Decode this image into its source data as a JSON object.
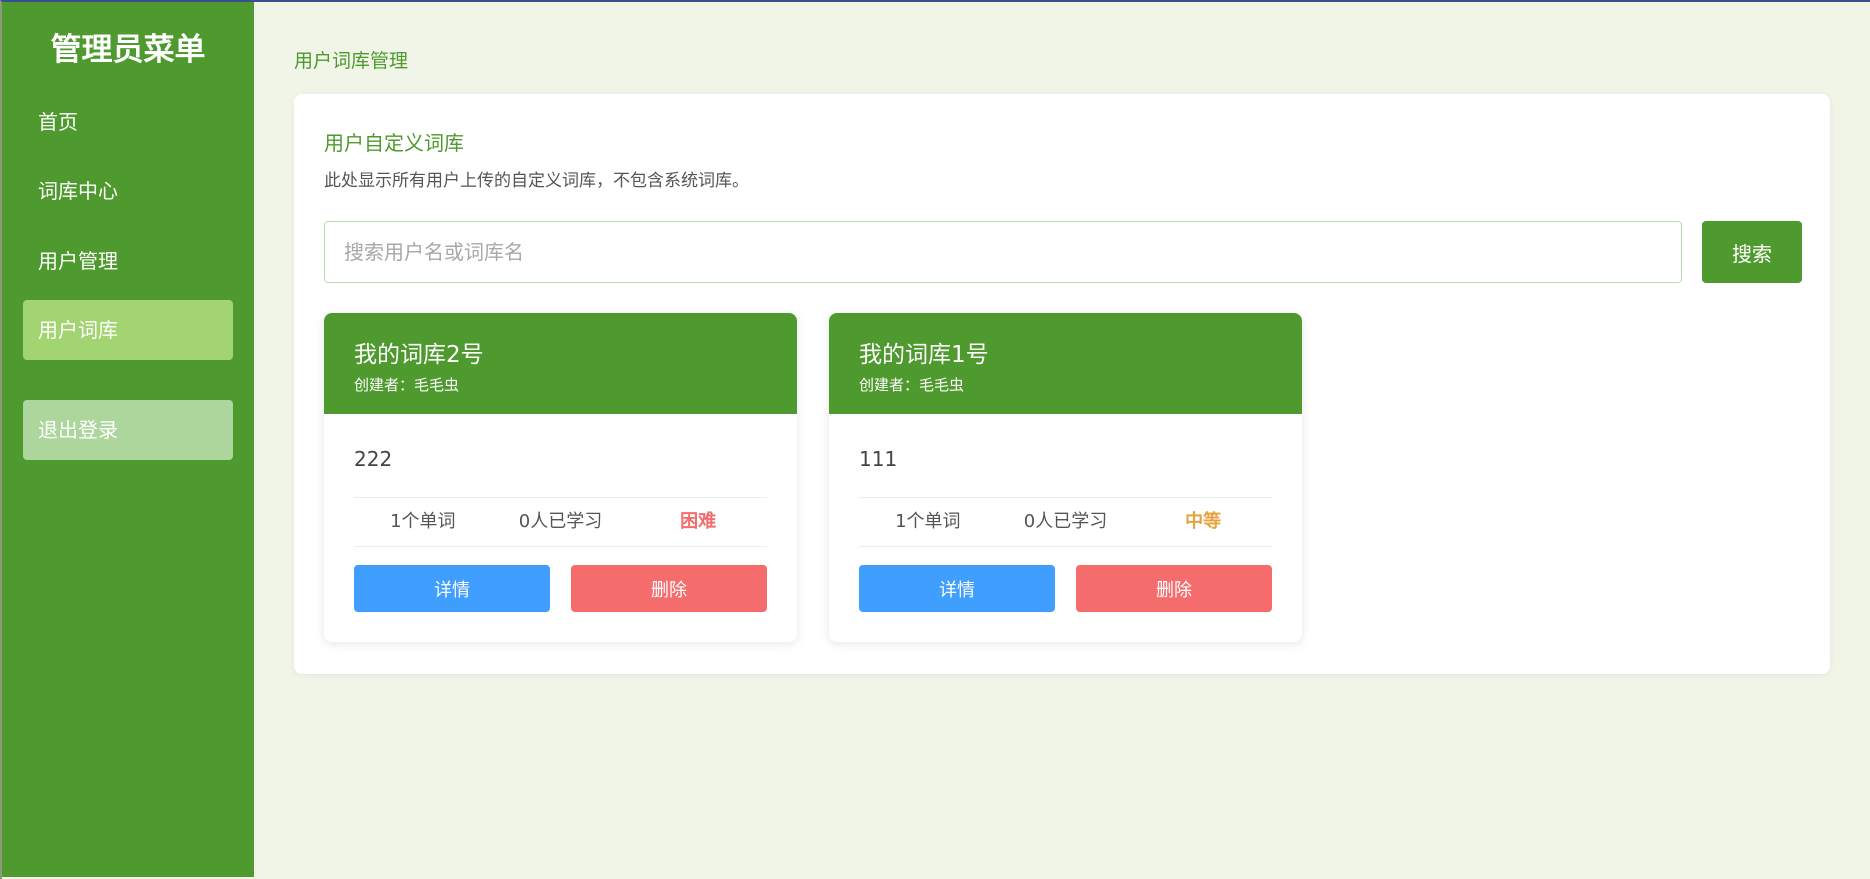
{
  "sidebar": {
    "title": "管理员菜单",
    "items": [
      {
        "label": "首页"
      },
      {
        "label": "词库中心"
      },
      {
        "label": "用户管理"
      },
      {
        "label": "用户词库"
      }
    ],
    "logout_label": "退出登录"
  },
  "main": {
    "breadcrumb": "用户词库管理",
    "section_title": "用户自定义词库",
    "section_desc": "此处显示所有用户上传的自定义词库，不包含系统词库。",
    "search": {
      "placeholder": "搜索用户名或词库名",
      "value": "",
      "button_label": "搜索"
    },
    "cards": [
      {
        "title": "我的词库2号",
        "creator": "创建者：毛毛虫",
        "description": "222",
        "word_count": "1个单词",
        "learners": "0人已学习",
        "difficulty": "困难",
        "difficulty_color": "#f56c6c",
        "detail_label": "详情",
        "delete_label": "删除"
      },
      {
        "title": "我的词库1号",
        "creator": "创建者：毛毛虫",
        "description": "111",
        "word_count": "1个单词",
        "learners": "0人已学习",
        "difficulty": "中等",
        "difficulty_color": "#e6a23c",
        "detail_label": "详情",
        "delete_label": "删除"
      }
    ]
  },
  "colors": {
    "primary_green": "#4e9a2e",
    "active_nav": "#a3d472",
    "logout_bg": "#acd69c",
    "detail_button": "#409eff",
    "delete_button": "#f56c6c",
    "page_bg": "#f0f5e8"
  }
}
